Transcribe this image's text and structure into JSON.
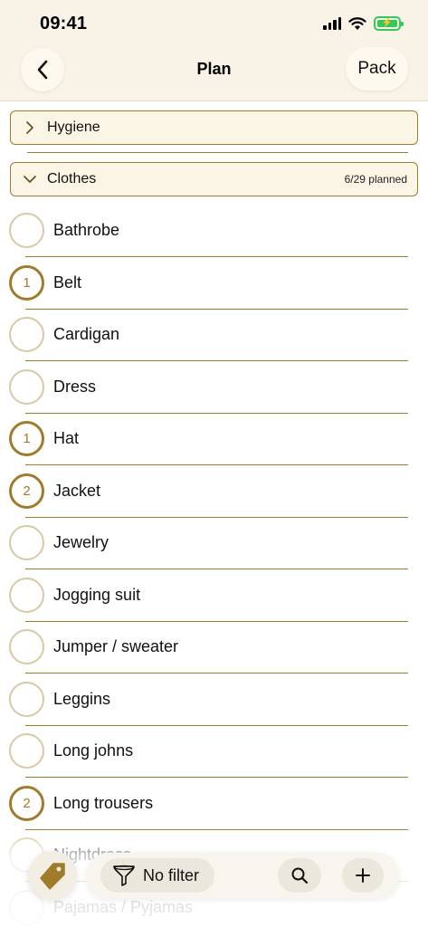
{
  "status": {
    "time": "09:41"
  },
  "nav": {
    "title": "Plan",
    "pack_label": "Pack"
  },
  "sections": [
    {
      "title": "Hygiene",
      "expanded": false
    },
    {
      "title": "Clothes",
      "expanded": true,
      "count": "6/29 planned"
    }
  ],
  "items": [
    {
      "label": "Bathrobe",
      "qty": ""
    },
    {
      "label": "Belt",
      "qty": "1"
    },
    {
      "label": "Cardigan",
      "qty": ""
    },
    {
      "label": "Dress",
      "qty": ""
    },
    {
      "label": "Hat",
      "qty": "1"
    },
    {
      "label": "Jacket",
      "qty": "2"
    },
    {
      "label": "Jewelry",
      "qty": ""
    },
    {
      "label": "Jogging suit",
      "qty": ""
    },
    {
      "label": "Jumper / sweater",
      "qty": ""
    },
    {
      "label": "Leggins",
      "qty": ""
    },
    {
      "label": "Long johns",
      "qty": ""
    },
    {
      "label": "Long trousers",
      "qty": "2"
    },
    {
      "label": "Nightdress",
      "qty": ""
    },
    {
      "label": "Pajamas / Pyjamas",
      "qty": ""
    }
  ],
  "toolbar": {
    "filter_label": "No filter"
  },
  "colors": {
    "accent": "#a07b2c",
    "background": "#f8f3e6"
  },
  "icons": [
    "back-chevron-icon",
    "chevron-right-icon",
    "chevron-down-icon",
    "tag-icon",
    "funnel-icon",
    "search-icon",
    "plus-icon"
  ]
}
